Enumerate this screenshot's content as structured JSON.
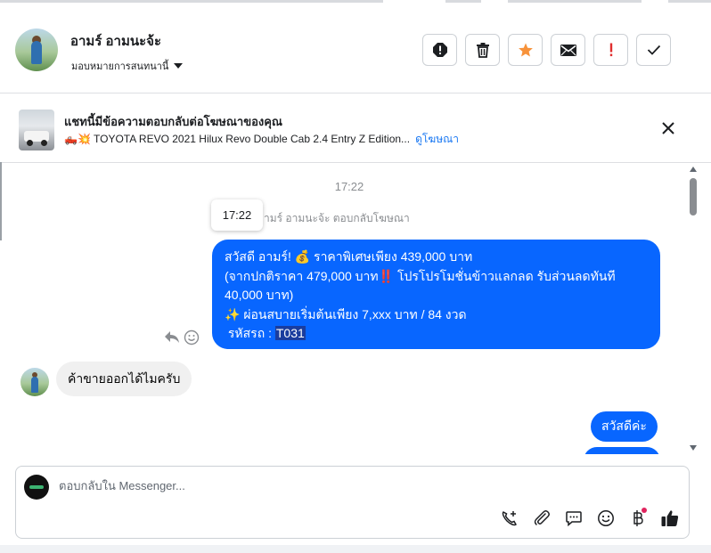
{
  "header": {
    "contact_name": "อามร์ อามนะจ้ะ",
    "assign_label": "มอบหมายการสนทนานี้",
    "actions": [
      {
        "name": "spam-button",
        "icon": "alert-octagon-icon"
      },
      {
        "name": "delete-button",
        "icon": "trash-icon"
      },
      {
        "name": "star-button",
        "icon": "star-icon"
      },
      {
        "name": "mark-unread-button",
        "icon": "envelope-icon"
      },
      {
        "name": "follow-up-button",
        "icon": "exclamation-icon"
      },
      {
        "name": "mark-done-button",
        "icon": "check-icon"
      }
    ]
  },
  "ad_banner": {
    "title": "แชทนี้มีข้อความตอบกลับต่อโฆษณาของคุณ",
    "subtitle": "🛻💥 TOYOTA REVO 2021 Hilux Revo Double Cab 2.4 Entry Z Edition...",
    "link": "ดูโฆษณา"
  },
  "conversation": {
    "timestamp": "17:22",
    "tooltip": "17:22",
    "replied_note": "ามร์ อามนะจ้ะ ตอบกลับโฆษณา",
    "ad_message_lines": [
      "สวัสดี อามร์! 💰 ราคาพิเศษเพียง 439,000 บาท",
      "(จากปกติราคา 479,000 บาท‼️ โปรโปรโมชั่นข้าวแลกลด รับส่วนลดทันที",
      "40,000 บาท)",
      "✨ ผ่อนสบายเริ่มต้นเพียง 7,xxx บาท / 84 งวด"
    ],
    "code_label": " รหัสรถ : ",
    "code_value": "T031",
    "incoming_message": "ค้าขายออกได้ไมครับ",
    "outgoing_message": "สวัสดีค่ะ"
  },
  "composer": {
    "placeholder": "ตอบกลับใน Messenger..."
  },
  "colors": {
    "accent": "#0866ff",
    "bubble_grey": "#f0f0f0",
    "star": "#f7923a",
    "follow_up": "#e02e2e"
  }
}
